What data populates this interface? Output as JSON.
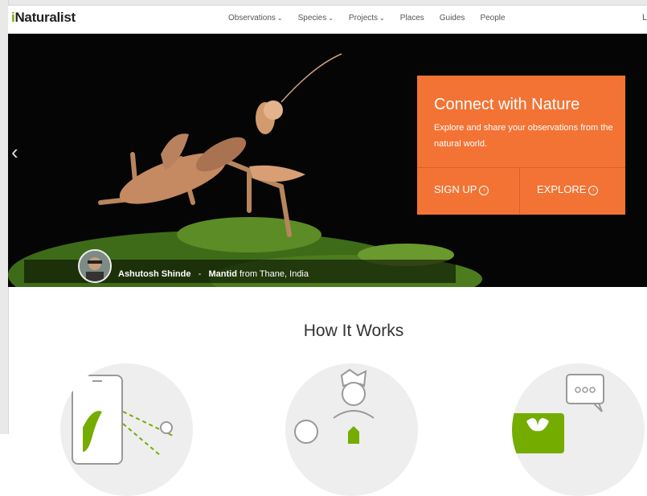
{
  "nav": {
    "logo": "iNaturalist",
    "items": [
      "Observations",
      "Species",
      "Projects",
      "Places",
      "Guides",
      "People"
    ],
    "cut_text": "L"
  },
  "hero": {
    "title": "Connect with Nature",
    "subtitle": "Explore and share your observations from the natural world.",
    "signup_label": "SIGN UP",
    "explore_label": "EXPLORE",
    "credit_name": "Ashutosh Shinde",
    "credit_sep": "-",
    "credit_species": "Mantid",
    "credit_place": "from Thane, India",
    "accent": "#f37334"
  },
  "section": {
    "title": "How It Works"
  }
}
